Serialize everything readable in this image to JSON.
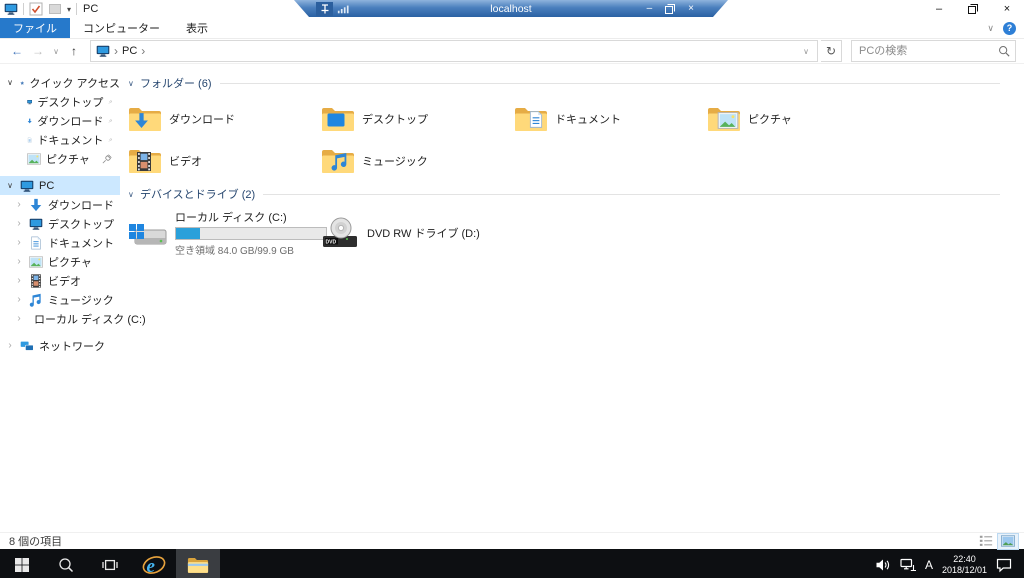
{
  "rdp_bar": {
    "host": "localhost",
    "minimize_glyph": "–",
    "close_glyph": "×"
  },
  "title_bar": {
    "title": "PC",
    "minimize_glyph": "–",
    "close_glyph": "×",
    "qat_dropdown_glyph": "▾"
  },
  "ribbon": {
    "tabs": [
      "ファイル",
      "コンピューター",
      "表示"
    ],
    "collapse_glyph": "∨",
    "help_glyph": "?"
  },
  "address_bar": {
    "back_glyph": "←",
    "forward_glyph": "→",
    "history_glyph": "∨",
    "up_glyph": "↑",
    "location": "PC",
    "chevron": "›",
    "dropdown_glyph": "∨",
    "refresh_glyph": "↻",
    "search_placeholder": "PCの検索"
  },
  "sidebar": {
    "quick_access": {
      "label": "クイック アクセス",
      "items": [
        {
          "label": "デスクトップ"
        },
        {
          "label": "ダウンロード"
        },
        {
          "label": "ドキュメント"
        },
        {
          "label": "ピクチャ"
        }
      ]
    },
    "pc": {
      "label": "PC",
      "items": [
        {
          "label": "ダウンロード"
        },
        {
          "label": "デスクトップ"
        },
        {
          "label": "ドキュメント"
        },
        {
          "label": "ピクチャ"
        },
        {
          "label": "ビデオ"
        },
        {
          "label": "ミュージック"
        },
        {
          "label": "ローカル ディスク (C:)"
        }
      ]
    },
    "network": {
      "label": "ネットワーク"
    }
  },
  "main": {
    "folders_section": {
      "title": "フォルダー (6)",
      "items": [
        {
          "label": "ダウンロード"
        },
        {
          "label": "デスクトップ"
        },
        {
          "label": "ドキュメント"
        },
        {
          "label": "ピクチャ"
        },
        {
          "label": "ビデオ"
        },
        {
          "label": "ミュージック"
        }
      ]
    },
    "drives_section": {
      "title": "デバイスとドライブ (2)",
      "local_disk": {
        "name": "ローカル ディスク (C:)",
        "free_label": "空き領域 84.0 GB/99.9 GB",
        "used_percent": "16%",
        "bar_style": "width:16%"
      },
      "dvd": {
        "name": "DVD RW ドライブ (D:)",
        "icon_label": "DVD"
      }
    }
  },
  "status_bar": {
    "items_count": "8 個の項目"
  },
  "taskbar": {
    "ime": "A",
    "time": "22:40",
    "date": "2018/12/01"
  },
  "colors": {
    "accent": "#2679cb",
    "selection": "#cce8ff",
    "capacity_fill": "#2aa0da",
    "taskbar": "#0d0f12",
    "folder_yellow": "#ffd97a",
    "rdp_blue": "#3c76b5"
  }
}
